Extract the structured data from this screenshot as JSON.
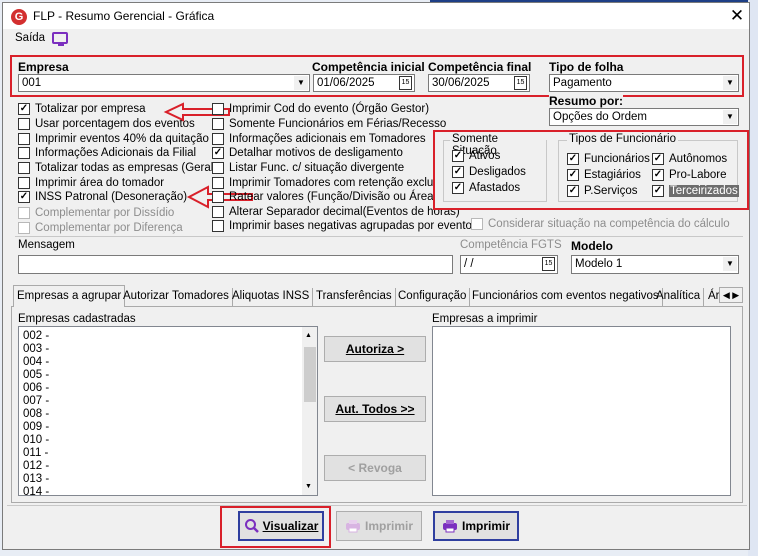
{
  "window": {
    "title": "FLP - Resumo Gerencial - Gráfica"
  },
  "menu": {
    "saida": "Saída"
  },
  "empresa": {
    "label": "Empresa",
    "value": "001"
  },
  "competencia_inicial": {
    "label": "Competência inicial",
    "value": "01/06/2025"
  },
  "competencia_final": {
    "label": "Competência final",
    "value": "30/06/2025"
  },
  "tipo_folha": {
    "label": "Tipo de folha",
    "value": "Pagamento"
  },
  "resumo_por": {
    "label": "Resumo por:",
    "value": "Opções do Ordem"
  },
  "options_left": [
    {
      "label": "Totalizar por empresa",
      "checked": true,
      "enabled": true
    },
    {
      "label": "Usar porcentagem dos eventos",
      "checked": false,
      "enabled": true
    },
    {
      "label": "Imprimir eventos 40% da quitação",
      "checked": false,
      "enabled": true
    },
    {
      "label": "Informações Adicionais da Filial",
      "checked": false,
      "enabled": true
    },
    {
      "label": "Totalizar todas as empresas (Geral)",
      "checked": false,
      "enabled": true
    },
    {
      "label": "Imprimir área do tomador",
      "checked": false,
      "enabled": true
    },
    {
      "label": "INSS Patronal (Desoneração)",
      "checked": true,
      "enabled": true
    },
    {
      "label": "Complementar por Dissídio",
      "checked": false,
      "enabled": false
    },
    {
      "label": "Complementar por Diferença",
      "checked": false,
      "enabled": false
    }
  ],
  "options_mid": [
    {
      "label": "Imprimir Cod do evento (Órgão Gestor)",
      "checked": false
    },
    {
      "label": "Somente Funcionários em Férias/Recesso",
      "checked": false
    },
    {
      "label": "Informações adicionais em Tomadores",
      "checked": false
    },
    {
      "label": "Detalhar motivos de desligamento",
      "checked": true
    },
    {
      "label": "Listar Func. c/ situação divergente",
      "checked": false
    },
    {
      "label": "Imprimir Tomadores com retenção exclusiva",
      "checked": false
    },
    {
      "label": "Ratear valores (Função/Divisão ou Área)",
      "checked": false
    },
    {
      "label": "Alterar Separador decimal(Eventos de horas)",
      "checked": false
    },
    {
      "label": "Imprimir bases negativas agrupadas por evento",
      "checked": false
    }
  ],
  "situacao": {
    "title": "Somente Situação",
    "items": [
      {
        "label": "Ativos",
        "checked": true
      },
      {
        "label": "Desligados",
        "checked": true
      },
      {
        "label": "Afastados",
        "checked": true
      }
    ]
  },
  "tipos_funcionario": {
    "title": "Tipos de Funcionário",
    "col1": [
      {
        "label": "Funcionários",
        "checked": true
      },
      {
        "label": "Estagiários",
        "checked": true
      },
      {
        "label": "P.Serviços",
        "checked": true
      }
    ],
    "col2": [
      {
        "label": "Autônomos",
        "checked": true
      },
      {
        "label": "Pro-Labore",
        "checked": true
      },
      {
        "label": "Terceirizados",
        "checked": true
      }
    ]
  },
  "considerar": {
    "label": "Considerar situação na competência do cálculo",
    "checked": false
  },
  "mensagem": {
    "label": "Mensagem",
    "value": ""
  },
  "competencia_fgts": {
    "label": "Competência FGTS",
    "value": " /  /"
  },
  "modelo": {
    "label": "Modelo",
    "value": "Modelo 1"
  },
  "tabs": [
    "Empresas a agrupar",
    "Autorizar Tomadores",
    "Aliquotas INSS",
    "Transferências",
    "Configuração",
    "Funcionários com eventos negativos",
    "Analítica",
    "Ár"
  ],
  "empresas_cadastradas": {
    "label": "Empresas cadastradas",
    "items": [
      "002 -",
      "003 -",
      "004 -",
      "005 -",
      "006 -",
      "007 -",
      "008 -",
      "009 -",
      "010 -",
      "011 -",
      "012 -",
      "013 -",
      "014 -"
    ]
  },
  "empresas_imprimir": {
    "label": "Empresas a imprimir"
  },
  "buttons": {
    "autoriza": "Autoriza >",
    "aut_todos": "Aut. Todos >>",
    "revoga": "< Revoga",
    "visualizar": "Visualizar",
    "imprimir_disabled": "Imprimir",
    "imprimir": "Imprimir"
  },
  "colors": {
    "highlight_red": "#d9202a",
    "accent_purple": "#7b2fbf"
  },
  "icons": [
    "close-icon",
    "monitor-icon",
    "calendar-icon",
    "chevron-down-icon",
    "search-icon",
    "printer-icon"
  ]
}
